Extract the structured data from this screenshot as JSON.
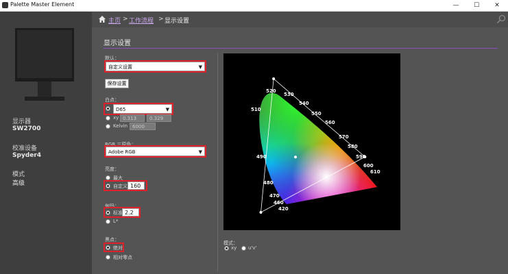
{
  "app": {
    "title": "Palette Master Element",
    "minimize": "—",
    "maximize": "☐",
    "close": "✕"
  },
  "sidebar": {
    "display_label": "显示器",
    "display_value": "SW2700",
    "device_label": "校准设备",
    "device_value": "Spyder4",
    "mode_label": "模式",
    "mode_value": "高级"
  },
  "breadcrumb": {
    "home": "主页",
    "sep1": ">",
    "workflow": "工作流程",
    "sep2": ">",
    "current": "显示设置"
  },
  "settings": {
    "section_title": "显示设置",
    "preset_label": "默认：",
    "preset_value": "自定义设置",
    "save_button": "保存设置",
    "white_label": "白点：",
    "white_preset": "D65",
    "white_xy_label": "xy",
    "white_x": "0.313",
    "white_y": "0.329",
    "white_kelvin_label": "Kelvin",
    "white_kelvin": "6000",
    "gamut_label": "RGB 三原色：",
    "gamut_value": "Adobe RGB",
    "luminance_label": "亮度：",
    "luminance_max": "最大",
    "luminance_custom": "自定义",
    "luminance_value": "160",
    "gamma_label": "伽玛：",
    "gamma_std": "标准",
    "gamma_value": "2.2",
    "gamma_lstar": "L*",
    "black_label": "黑点：",
    "black_abs": "绝对",
    "black_rel": "相对零点",
    "chart_mode_label": "模式：",
    "chart_mode_xy": "xy",
    "chart_mode_uv": "u'v'"
  },
  "chart_data": {
    "type": "scatter",
    "title": "",
    "wavelength_labels": [
      "420",
      "460",
      "470",
      "480",
      "490",
      "510",
      "520",
      "530",
      "540",
      "550",
      "560",
      "570",
      "580",
      "590",
      "600",
      "610"
    ],
    "gamut_triangle": {
      "red": [
        0.64,
        0.33
      ],
      "green": [
        0.21,
        0.71
      ],
      "blue": [
        0.15,
        0.06
      ]
    },
    "white_point": [
      0.313,
      0.329
    ]
  },
  "colors": {
    "accent": "#8c4fc3",
    "highlight": "#e0212b",
    "link": "#c9a9ec"
  }
}
